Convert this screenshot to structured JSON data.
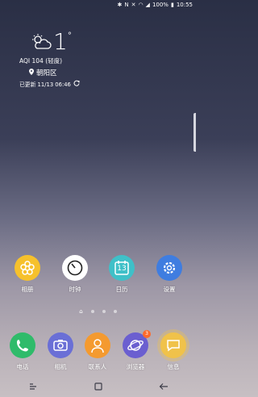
{
  "status_bar": {
    "battery": "100%",
    "time": "10:55",
    "icons": [
      "bluetooth-icon",
      "nfc-icon",
      "mute-icon",
      "wifi-icon",
      "signal-icon",
      "battery-icon"
    ]
  },
  "weather": {
    "icon": "partly-cloudy-icon",
    "temperature": "1",
    "degree": "°",
    "aqi": "AQI 104 (轻度)",
    "location": "朝阳区",
    "updated": "已更新 11/13 06:46"
  },
  "apps": [
    {
      "label": "相册",
      "color": "#f6c12c",
      "icon": "flower-icon"
    },
    {
      "label": "时钟",
      "color": "#ffffff",
      "icon": "clock-icon"
    },
    {
      "label": "日历",
      "color": "#3fc0c8",
      "icon": "calendar-icon",
      "calendar_day": "13"
    },
    {
      "label": "设置",
      "color": "#3f7de0",
      "icon": "gear-icon"
    }
  ],
  "dock": [
    {
      "label": "电话",
      "color": "#2fbb6a",
      "icon": "phone-icon"
    },
    {
      "label": "相机",
      "color": "#6a6fd6",
      "icon": "camera-icon"
    },
    {
      "label": "联系人",
      "color": "#f49a2f",
      "icon": "contact-icon"
    },
    {
      "label": "浏览器",
      "color": "#6b5fd0",
      "icon": "browser-icon",
      "badge": "3"
    },
    {
      "label": "信息",
      "color": "#f0c24a",
      "icon": "message-icon"
    }
  ],
  "nav": [
    "recents-icon",
    "home-icon",
    "back-icon"
  ]
}
